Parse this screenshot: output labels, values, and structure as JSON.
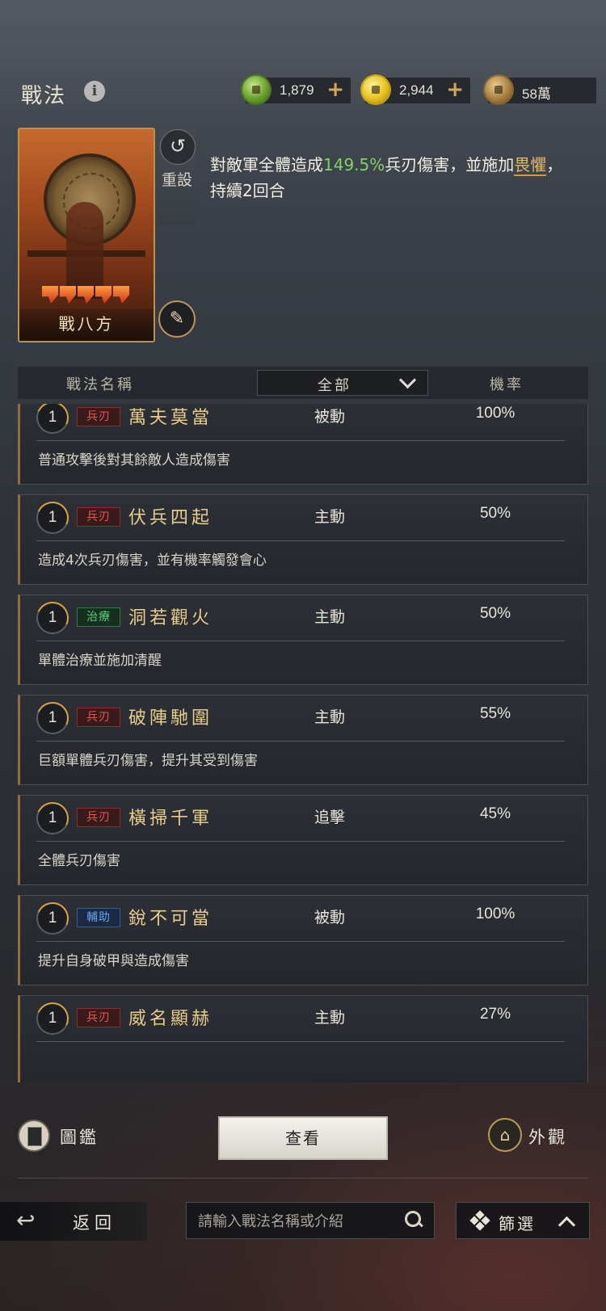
{
  "header": {
    "title": "戰法",
    "info_icon": "i",
    "currencies": [
      {
        "icon": "jade-coin-icon",
        "amount": "1,879",
        "plus": "+"
      },
      {
        "icon": "gold-coin-icon",
        "amount": "2,944",
        "plus": "+"
      },
      {
        "icon": "copper-coin-icon",
        "amount": "58萬"
      }
    ]
  },
  "selected_skill": {
    "name": "戰八方",
    "stars": 5,
    "reset_label": "重設",
    "description_parts": {
      "before": "對敵軍全體造成",
      "value": "149.5%",
      "middle": "兵刃傷害，並施加",
      "keyword": "畏懼",
      "after": "，持續2回合"
    }
  },
  "list_header": {
    "name_col": "戰法名稱",
    "filter_value": "全部",
    "rate_col": "機率"
  },
  "skills": [
    {
      "level": "1",
      "tag": "兵刃",
      "name": "萬夫莫當",
      "type": "被動",
      "rate": "100%",
      "desc": "普通攻擊後對其餘敵人造成傷害"
    },
    {
      "level": "1",
      "tag": "兵刃",
      "name": "伏兵四起",
      "type": "主動",
      "rate": "50%",
      "desc": "造成4次兵刃傷害，並有機率觸發會心"
    },
    {
      "level": "1",
      "tag": "治療",
      "name": "洞若觀火",
      "type": "主動",
      "rate": "50%",
      "desc": "單體治療並施加清醒"
    },
    {
      "level": "1",
      "tag": "兵刃",
      "name": "破陣馳圍",
      "type": "主動",
      "rate": "55%",
      "desc": "巨額單體兵刃傷害，提升其受到傷害"
    },
    {
      "level": "1",
      "tag": "兵刃",
      "name": "橫掃千軍",
      "type": "追擊",
      "rate": "45%",
      "desc": "全體兵刃傷害"
    },
    {
      "level": "1",
      "tag": "輔助",
      "name": "銳不可當",
      "type": "被動",
      "rate": "100%",
      "desc": "提升自身破甲與造成傷害"
    },
    {
      "level": "1",
      "tag": "兵刃",
      "name": "威名顯赫",
      "type": "主動",
      "rate": "27%",
      "desc": ""
    }
  ],
  "actions": {
    "catalog_label": "圖鑑",
    "view_label": "查看",
    "appearance_label": "外觀"
  },
  "footer": {
    "back_label": "返回",
    "search_placeholder": "請輸入戰法名稱或介紹",
    "filter_label": "篩選"
  }
}
